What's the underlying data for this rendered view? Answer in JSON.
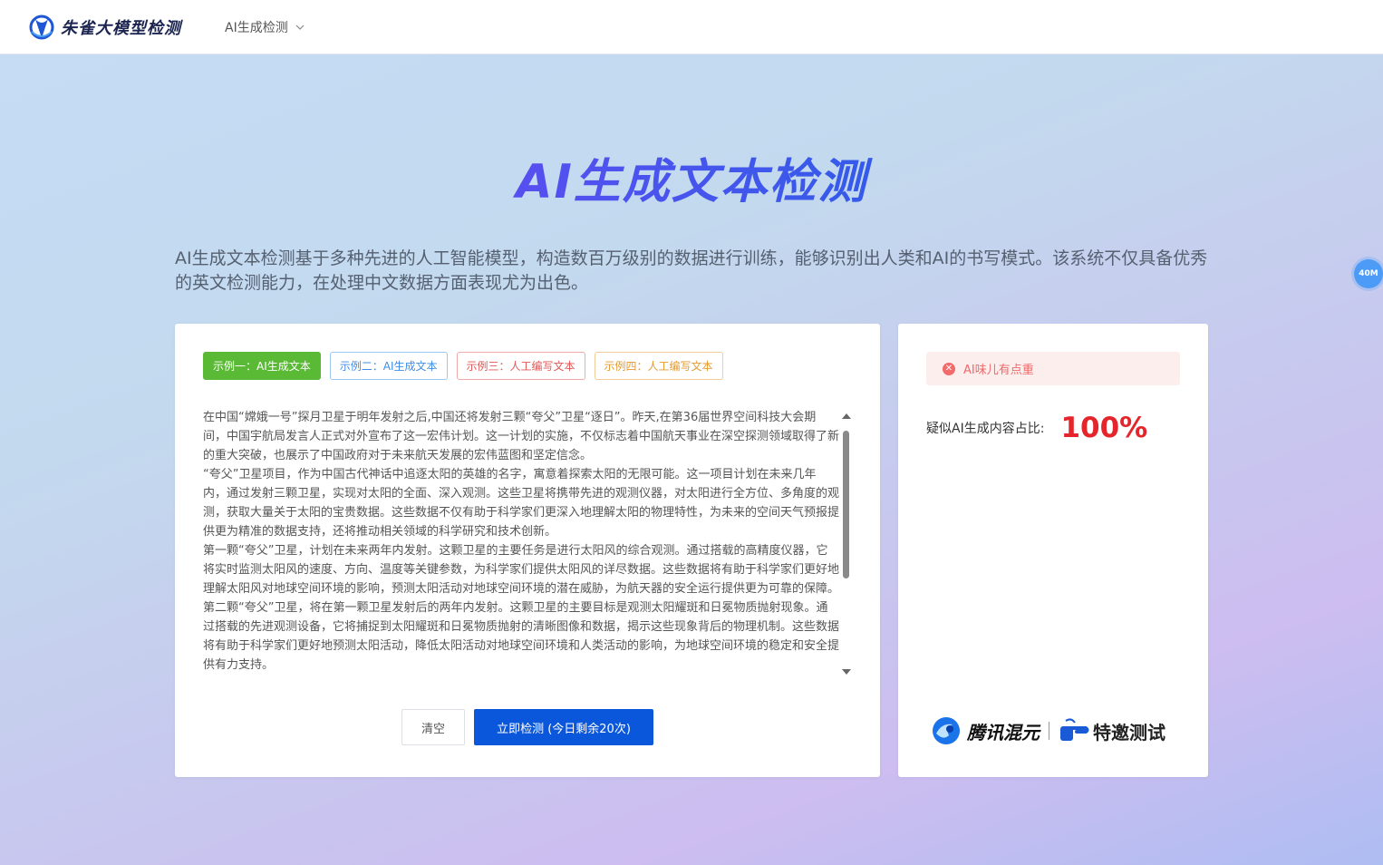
{
  "app": {
    "logo_text": "朱雀大模型检测",
    "nav_label": "AI生成检测"
  },
  "hero": {
    "title": "AI生成文本检测",
    "intro": "AI生成文本检测基于多种先进的人工智能模型，构造数百万级别的数据进行训练，能够识别出人类和AI的书写模式。该系统不仅具备优秀的英文检测能力，在处理中文数据方面表现尤为出色。"
  },
  "float_badge": "40M",
  "examples": [
    {
      "label": "示例一：AI生成文本"
    },
    {
      "label": "示例二：AI生成文本"
    },
    {
      "label": "示例三：人工编写文本"
    },
    {
      "label": "示例四：人工编写文本"
    }
  ],
  "input_text": "在中国“嫦娥一号”探月卫星于明年发射之后,中国还将发射三颗“夸父”卫星“逐日”。昨天,在第36届世界空间科技大会期间，中国宇航局发言人正式对外宣布了这一宏伟计划。这一计划的实施，不仅标志着中国航天事业在深空探测领域取得了新的重大突破，也展示了中国政府对于未来航天发展的宏伟蓝图和坚定信念。\n“夸父”卫星项目，作为中国古代神话中追逐太阳的英雄的名字，寓意着探索太阳的无限可能。这一项目计划在未来几年内，通过发射三颗卫星，实现对太阳的全面、深入观测。这些卫星将携带先进的观测仪器，对太阳进行全方位、多角度的观测，获取大量关于太阳的宝贵数据。这些数据不仅有助于科学家们更深入地理解太阳的物理特性，为未来的空间天气预报提供更为精准的数据支持，还将推动相关领域的科学研究和技术创新。\n第一颗“夸父”卫星，计划在未来两年内发射。这颗卫星的主要任务是进行太阳风的综合观测。通过搭载的高精度仪器，它将实时监测太阳风的速度、方向、温度等关键参数，为科学家们提供太阳风的详尽数据。这些数据将有助于科学家们更好地理解太阳风对地球空间环境的影响，预测太阳活动对地球空间环境的潜在威胁，为航天器的安全运行提供更为可靠的保障。\n第二颗“夸父”卫星，将在第一颗卫星发射后的两年内发射。这颗卫星的主要目标是观测太阳耀斑和日冕物质抛射现象。通过搭载的先进观测设备，它将捕捉到太阳耀斑和日冕物质抛射的清晰图像和数据，揭示这些现象背后的物理机制。这些数据将有助于科学家们更好地预测太阳活动，降低太阳活动对地球空间环境和人类活动的影响，为地球空间环境的稳定和安全提供有力支持。",
  "buttons": {
    "clear": "清空",
    "detect": "立即检测 (今日剩余20次)"
  },
  "result": {
    "alert": "AI味儿有点重",
    "label": "疑似AI生成内容占比:",
    "value": "100%"
  },
  "footer": {
    "partner": "腾讯混元",
    "invite": "特邀测试"
  },
  "colors": {
    "primary": "#0b57dc",
    "example1": "#5ab935",
    "result_red": "#e4262c"
  }
}
